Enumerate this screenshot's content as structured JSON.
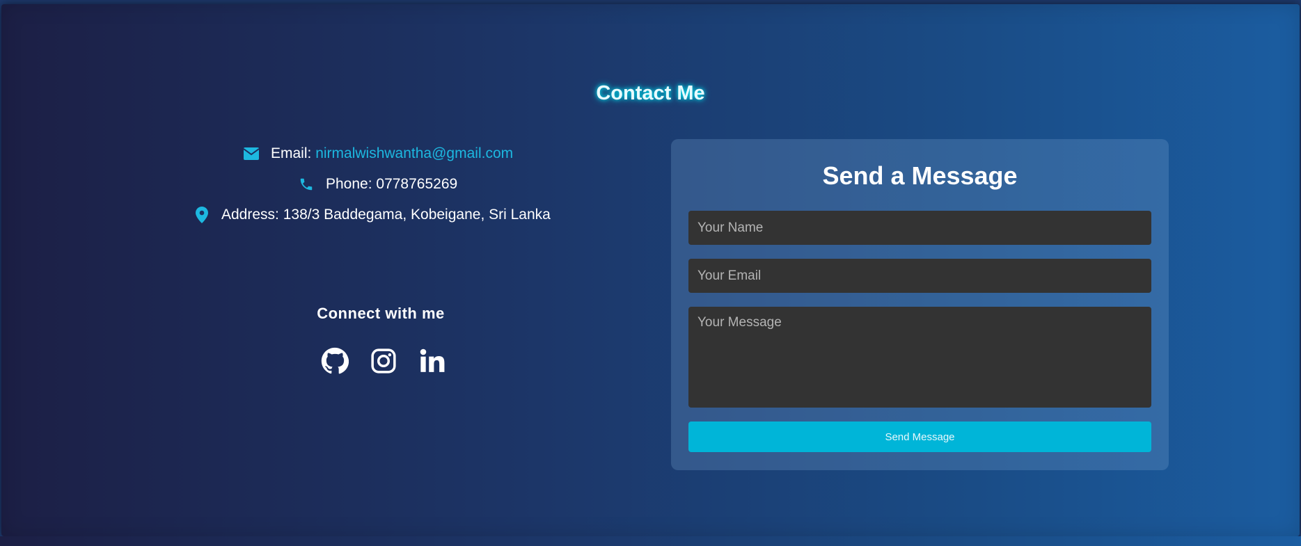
{
  "section_title": "Contact Me",
  "contact": {
    "email_label": "Email: ",
    "email_value": "nirmalwishwantha@gmail.com",
    "phone_label": "Phone: 0778765269",
    "address_label": "Address: 138/3 Baddegama, Kobeigane, Sri Lanka",
    "icons": [
      "envelope-icon",
      "phone-icon",
      "map-marker-icon"
    ]
  },
  "connect": {
    "title": "Connect with me",
    "socials": [
      "github-icon",
      "instagram-icon",
      "linkedin-icon"
    ]
  },
  "form": {
    "title": "Send a Message",
    "name_placeholder": "Your Name",
    "email_placeholder": "Your Email",
    "message_placeholder": "Your Message",
    "submit_label": "Send Message"
  },
  "colors": {
    "accent": "#00b5d8",
    "link": "#1db8e0",
    "title_glow": "#00d8e8",
    "input_bg": "#333333"
  }
}
